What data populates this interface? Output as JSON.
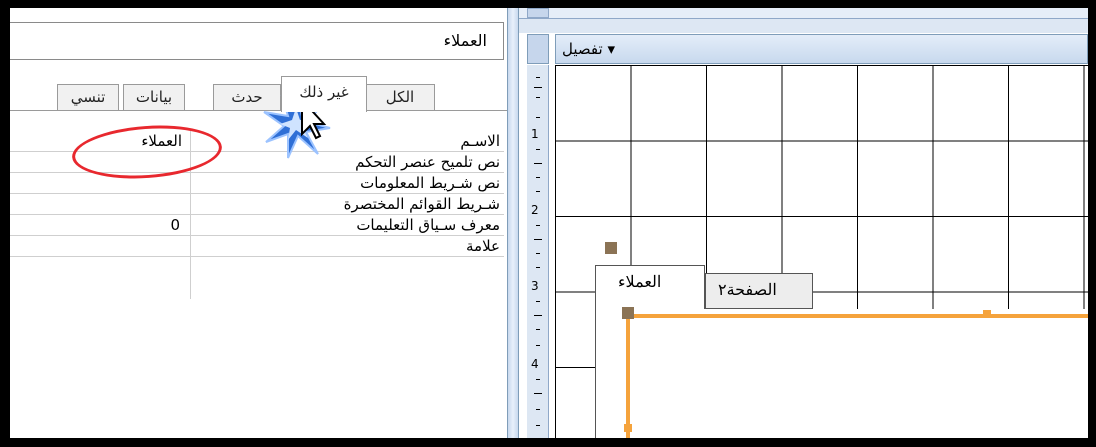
{
  "property_sheet": {
    "object_selector": "العملاء",
    "tabs": [
      "الكل",
      "غير ذلك",
      "حدث",
      "بيانات",
      "تنسي"
    ],
    "active_tab": "غير ذلك",
    "rows": [
      {
        "label": "الاسـم",
        "value": "العملاء"
      },
      {
        "label": "نص تلميح عنصر التحكم",
        "value": ""
      },
      {
        "label": "نص شـريط المعلومات",
        "value": ""
      },
      {
        "label": "شـريط القوائم المختصرة",
        "value": ""
      },
      {
        "label": "معرف سـياق التعليمات",
        "value": "0"
      },
      {
        "label": "علامة",
        "value": ""
      }
    ]
  },
  "designer": {
    "section_title": "تفصيل ▾",
    "ruler_numbers": [
      "1",
      "2",
      "3",
      "4"
    ],
    "tab_control": {
      "tabs": [
        "العملاء",
        "الصفحة٢"
      ]
    }
  },
  "colors": {
    "highlight_oval": "#e8282e",
    "selection_border": "#f5a33c",
    "cursor_burst": "#2f6fd6"
  },
  "icons": [
    "cursor-burst-icon",
    "section-arrow-icon"
  ]
}
